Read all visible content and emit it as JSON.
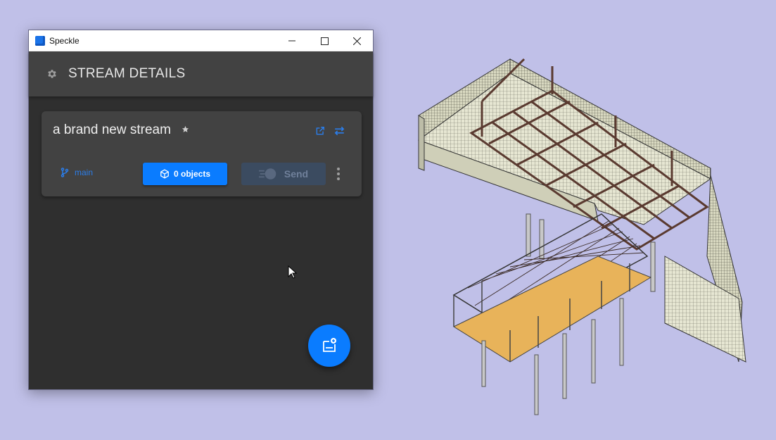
{
  "window": {
    "title": "Speckle",
    "controls": [
      "minimize",
      "maximize",
      "close"
    ]
  },
  "header": {
    "icon": "gear-icon",
    "title": "STREAM DETAILS"
  },
  "stream_card": {
    "name": "a brand new stream",
    "star_icon": "star-icon",
    "open_icon": "open-in-new-icon",
    "swap_icon": "swap-icon",
    "branch": {
      "icon": "branch-icon",
      "label": "main"
    },
    "objects_button": {
      "icon": "cube-icon",
      "label": "0 objects"
    },
    "send_button": {
      "icon": "send-icon",
      "label": "Send",
      "disabled": true
    },
    "more_icon": "more-vertical-icon"
  },
  "fab": {
    "icon": "add-stream-icon"
  },
  "colors": {
    "desktop": "#c0c0e8",
    "accent": "#0a7cff",
    "panel": "#424242",
    "background": "#2f2f2f",
    "deck": "#e8b35a",
    "steel": "#5a3a30"
  }
}
